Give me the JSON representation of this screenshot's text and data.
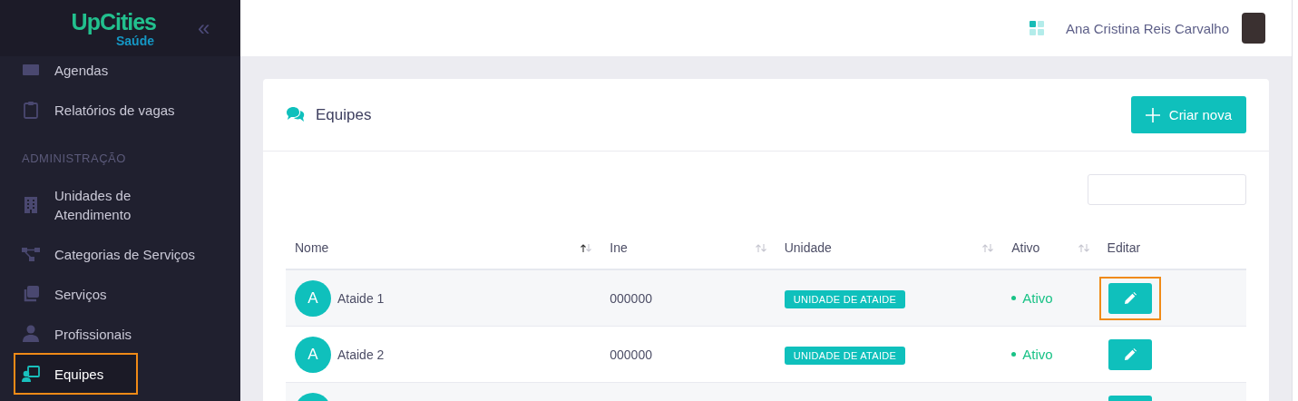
{
  "sidebar": {
    "logo": {
      "name": "UpCities",
      "subtitle": "Saúde"
    },
    "collapse_icon": "«",
    "items": [
      {
        "kind": "item",
        "label": "Agendas",
        "selected": false,
        "highlighted": false
      },
      {
        "kind": "item",
        "label": "Relatórios de vagas",
        "selected": false,
        "highlighted": false
      },
      {
        "kind": "section",
        "label": "ADMINISTRAÇÃO"
      },
      {
        "kind": "item",
        "label": "Unidades de Atendimento",
        "selected": false,
        "highlighted": false
      },
      {
        "kind": "item",
        "label": "Categorias de Serviços",
        "selected": false,
        "highlighted": false
      },
      {
        "kind": "item",
        "label": "Serviços",
        "selected": false,
        "highlighted": false
      },
      {
        "kind": "item",
        "label": "Profissionais",
        "selected": false,
        "highlighted": false
      },
      {
        "kind": "item",
        "label": "Equipes",
        "selected": true,
        "highlighted": true
      }
    ]
  },
  "header": {
    "user_name": "Ana Cristina Reis Carvalho"
  },
  "card": {
    "title": "Equipes",
    "create_button": "Criar nova",
    "table": {
      "columns": [
        {
          "label": "Nome",
          "sortable": true,
          "sorted_ascending": true
        },
        {
          "label": "Ine",
          "sortable": true,
          "sorted_ascending": false
        },
        {
          "label": "Unidade",
          "sortable": true,
          "sorted_ascending": false
        },
        {
          "label": "Ativo",
          "sortable": true,
          "sorted_ascending": false
        },
        {
          "label": "Editar",
          "sortable": false
        }
      ],
      "rows": [
        {
          "avatar": "A",
          "name": "Ataide 1",
          "ine": "000000",
          "unit": "UNIDADE DE ATAIDE",
          "status": "Ativo",
          "edit_highlighted": true
        },
        {
          "avatar": "A",
          "name": "Ataide 2",
          "ine": "000000",
          "unit": "UNIDADE DE ATAIDE",
          "status": "Ativo",
          "edit_highlighted": false
        },
        {
          "cut_off": true,
          "edit_highlighted": false
        }
      ]
    }
  }
}
